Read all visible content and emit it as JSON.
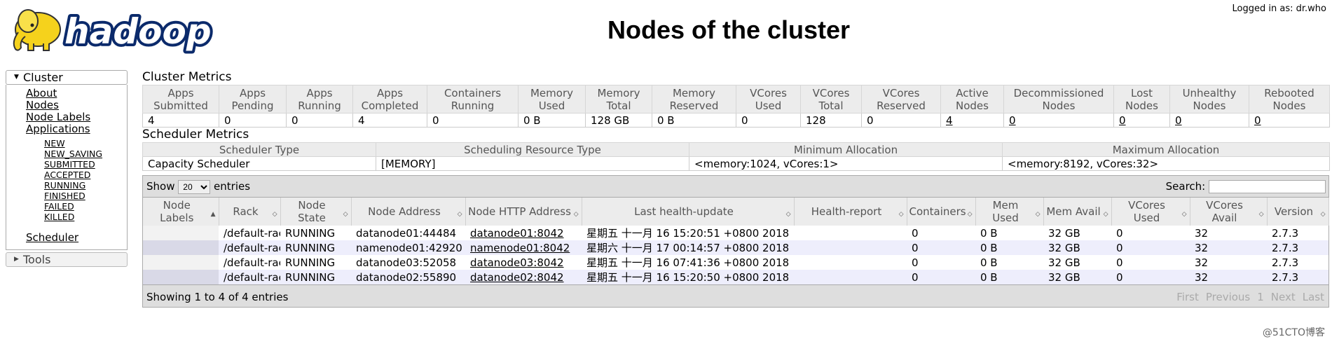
{
  "header": {
    "logo_text": "hadoop",
    "title": "Nodes of the cluster",
    "logged_in": "Logged in as: dr.who"
  },
  "sidebar": {
    "cluster_label": "Cluster",
    "links": [
      "About",
      "Nodes",
      "Node Labels",
      "Applications"
    ],
    "app_states": [
      "NEW",
      "NEW_SAVING",
      "SUBMITTED",
      "ACCEPTED",
      "RUNNING",
      "FINISHED",
      "FAILED",
      "KILLED"
    ],
    "scheduler": "Scheduler",
    "tools_label": "Tools"
  },
  "cluster_metrics": {
    "title": "Cluster Metrics",
    "headers": [
      "Apps Submitted",
      "Apps Pending",
      "Apps Running",
      "Apps Completed",
      "Containers Running",
      "Memory Used",
      "Memory Total",
      "Memory Reserved",
      "VCores Used",
      "VCores Total",
      "VCores Reserved",
      "Active Nodes",
      "Decommissioned Nodes",
      "Lost Nodes",
      "Unhealthy Nodes",
      "Rebooted Nodes"
    ],
    "values": [
      "4",
      "0",
      "0",
      "4",
      "0",
      "0 B",
      "128 GB",
      "0 B",
      "0",
      "128",
      "0",
      "4",
      "0",
      "0",
      "0",
      "0"
    ]
  },
  "scheduler_metrics": {
    "title": "Scheduler Metrics",
    "headers": [
      "Scheduler Type",
      "Scheduling Resource Type",
      "Minimum Allocation",
      "Maximum Allocation"
    ],
    "values": [
      "Capacity Scheduler",
      "[MEMORY]",
      "<memory:1024, vCores:1>",
      "<memory:8192, vCores:32>"
    ]
  },
  "nodes_table": {
    "show_label": "Show",
    "entries_label": "entries",
    "page_size": "20",
    "search_label": "Search:",
    "search_value": "",
    "headers": [
      "Node Labels",
      "Rack",
      "Node State",
      "Node Address",
      "Node HTTP Address",
      "Last health-update",
      "Health-report",
      "Containers",
      "Mem Used",
      "Mem Avail",
      "VCores Used",
      "VCores Avail",
      "Version"
    ],
    "rows": [
      [
        "",
        "/default-rack",
        "RUNNING",
        "datanode01:44484",
        "datanode01:8042",
        "星期五 十一月 16 15:20:51 +0800 2018",
        "",
        "0",
        "0 B",
        "32 GB",
        "0",
        "32",
        "2.7.3"
      ],
      [
        "",
        "/default-rack",
        "RUNNING",
        "namenode01:42920",
        "namenode01:8042",
        "星期六 十一月 17 00:14:57 +0800 2018",
        "",
        "0",
        "0 B",
        "32 GB",
        "0",
        "32",
        "2.7.3"
      ],
      [
        "",
        "/default-rack",
        "RUNNING",
        "datanode03:52058",
        "datanode03:8042",
        "星期五 十一月 16 07:41:36 +0800 2018",
        "",
        "0",
        "0 B",
        "32 GB",
        "0",
        "32",
        "2.7.3"
      ],
      [
        "",
        "/default-rack",
        "RUNNING",
        "datanode02:55890",
        "datanode02:8042",
        "星期五 十一月 16 15:20:50 +0800 2018",
        "",
        "0",
        "0 B",
        "32 GB",
        "0",
        "32",
        "2.7.3"
      ]
    ],
    "showing": "Showing 1 to 4 of 4 entries",
    "pager": [
      "First",
      "Previous",
      "1",
      "Next",
      "Last"
    ]
  },
  "watermark": "@51CTO博客",
  "colors": {
    "header_bg": "#ececec",
    "even_row": "#eeeefc",
    "toolbar_bg": "#dedede"
  }
}
